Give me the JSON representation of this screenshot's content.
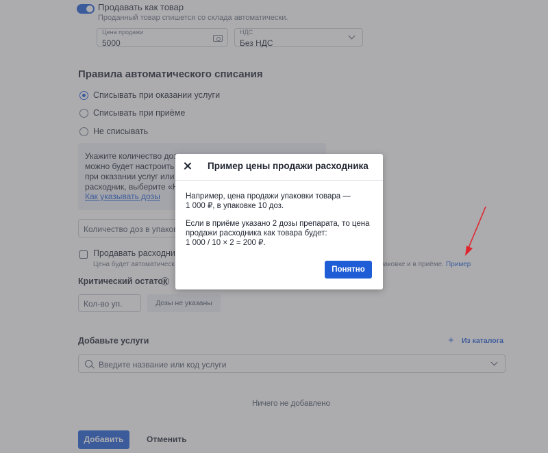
{
  "sell_as_product": {
    "label": "Продавать как товар",
    "hint": "Проданный товар спишется со склада автоматически.",
    "enabled": true
  },
  "price_field": {
    "label": "Цена продажи",
    "value": "5000"
  },
  "vat_field": {
    "label": "НДС",
    "value": "Без НДС"
  },
  "write_off": {
    "title": "Правила автоматического списания",
    "options": [
      {
        "label": "Списывать при оказании услуги",
        "checked": true
      },
      {
        "label": "Списывать при приёме",
        "checked": false
      },
      {
        "label": "Не списывать",
        "checked": false
      }
    ],
    "info_lines": [
      "Укажите количество доз",
      "можно будет настроить а",
      "при оказании услуг или в",
      "расходник, выберите «Не"
    ],
    "info_link": "Как указывать дозы",
    "doses_placeholder": "Количество доз в упаковке"
  },
  "sell_consumable": {
    "label": "Продавать расходники",
    "hint": "Цена будет автоматическ",
    "hint_tail": "паковке и в приёме.",
    "example_link": "Пример"
  },
  "critical_stock": {
    "title": "Критический остаток",
    "info_icon": "i",
    "qty_placeholder": "Кол-во уп.",
    "doses_badge": "Дозы не указаны"
  },
  "services": {
    "title": "Добавьте услуги",
    "from_catalog": "Из каталога",
    "plus": "+",
    "search_placeholder": "Введите название или код услуги",
    "empty": "Ничего не добавлено"
  },
  "actions": {
    "add": "Добавить",
    "cancel": "Отменить"
  },
  "modal": {
    "title": "Пример цены продажи расходника",
    "p1_line1": "Например, цена продажи упаковки товара —",
    "p1_line2": "1 000 ₽, в упаковке 10 доз.",
    "p2_line1": "Если в приёме указано 2 дозы препарата, то цена",
    "p2_line2": "продажи расходника как товара будет:",
    "p2_line3": "1 000 / 10 × 2 = 200 ₽.",
    "ok": "Понятно"
  },
  "colors": {
    "accent": "#1f5dd6",
    "annotation_arrow": "#e0242c"
  }
}
